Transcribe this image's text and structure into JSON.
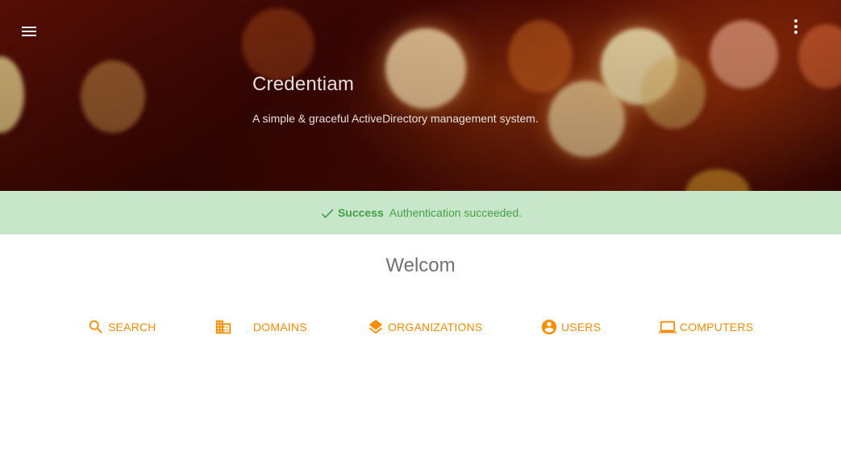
{
  "header": {
    "title": "Credentiam",
    "subtitle": "A simple & graceful ActiveDirectory management system.",
    "menu_icon": "menu-icon",
    "more_icon": "more-vert-icon"
  },
  "alert": {
    "icon": "check-icon",
    "label": "Success",
    "message": "Authentication succeeded.",
    "background": "#c8e6c9",
    "color": "#43a047"
  },
  "main": {
    "welcome": "Welcom",
    "accent": "#fb8c00",
    "nav": [
      {
        "label": "SEARCH",
        "icon": "search-icon"
      },
      {
        "label": "DOMAINS",
        "icon": "domain-icon"
      },
      {
        "label": "ORGANIZATIONS",
        "icon": "layers-icon"
      },
      {
        "label": "USERS",
        "icon": "account-circle-icon"
      },
      {
        "label": "COMPUTERS",
        "icon": "laptop-icon"
      }
    ]
  }
}
